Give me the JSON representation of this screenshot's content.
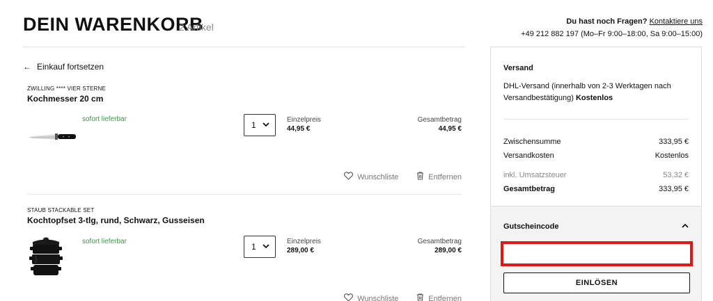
{
  "header": {
    "title": "DEIN WARENKORB",
    "count": "2 Artikel",
    "help_question": "Du hast noch Fragen?",
    "help_link": "Kontaktiere uns",
    "help_phone": "+49 212 882 197 (Mo–Fr 9:00–18:00, Sa 9:00–15:00)"
  },
  "back_link": {
    "arrow": "←",
    "label": "Einkauf fortsetzen"
  },
  "items": [
    {
      "brand": "ZWILLING **** VIER STERNE",
      "name": "Kochmesser 20 cm",
      "availability": "sofort lieferbar",
      "quantity": "1",
      "unit_label": "Einzelpreis",
      "unit_price": "44,95 €",
      "total_label": "Gesamtbetrag",
      "total_price": "44,95 €",
      "wishlist": "Wunschliste",
      "remove": "Entfernen"
    },
    {
      "brand": "STAUB STACKABLE SET",
      "name": "Kochtopfset 3-tlg, rund, Schwarz, Gusseisen",
      "availability": "sofort lieferbar",
      "quantity": "1",
      "unit_label": "Einzelpreis",
      "unit_price": "289,00 €",
      "total_label": "Gesamtbetrag",
      "total_price": "289,00 €",
      "wishlist": "Wunschliste",
      "remove": "Entfernen"
    }
  ],
  "sidebar": {
    "shipping_title": "Versand",
    "shipping_text": "DHL-Versand (innerhalb von 2-3 Werktagen nach Versandbestätigung)",
    "shipping_cost_label": "Kostenlos",
    "subtotal_label": "Zwischensumme",
    "subtotal_value": "333,95 €",
    "shipping_label": "Versandkosten",
    "shipping_value": "Kostenlos",
    "tax_label": "inkl. Umsatzsteuer",
    "tax_value": "53,32 €",
    "grand_total_label": "Gesamtbetrag",
    "grand_total_value": "333,95 €",
    "coupon_title": "Gutscheincode",
    "coupon_value": "",
    "redeem_label": "EINLÖSEN"
  },
  "icons": {
    "chevron": "chevron-down-icon",
    "heart": "heart-icon",
    "trash": "trash-icon"
  },
  "colors": {
    "availability": "#2e9e3b",
    "highlight": "#e01717",
    "coupon_bg": "#f3f3f3"
  }
}
